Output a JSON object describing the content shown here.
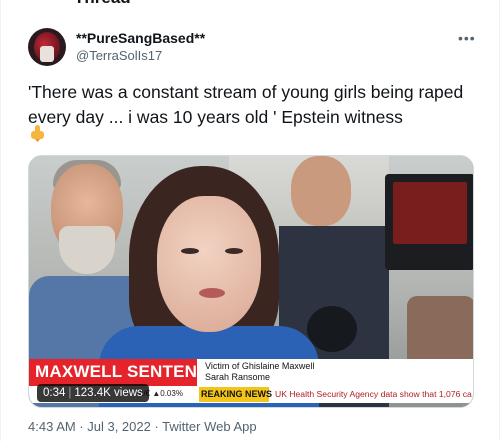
{
  "header": {
    "title": "Thread"
  },
  "author": {
    "display_name": "**PureSangBased**",
    "handle": "@TerraSolIs17"
  },
  "tweet": {
    "text": "'There was a constant stream of young girls being raped every day ... i was 10 years old ' Epstein witness",
    "emoji_icon": "pointing-down-hand-icon"
  },
  "media": {
    "headline": "MAXWELL SENTENCING",
    "caption_line1": "Victim of Ghislaine Maxwell",
    "caption_line2": "Sarah Ransome",
    "fx": "£/€ ▲0.03%",
    "breaking": "REAKING NEWS",
    "ticker": "UK Health Security Agency data show that 1,076 ca",
    "duration": "0:34",
    "views": "123.4K views",
    "colors": {
      "headline_red": "#e4242a",
      "breaking_yellow": "#f3c41a"
    }
  },
  "meta": {
    "timestamp": "4:43 AM · Jul 3, 2022 · Twitter Web App"
  }
}
